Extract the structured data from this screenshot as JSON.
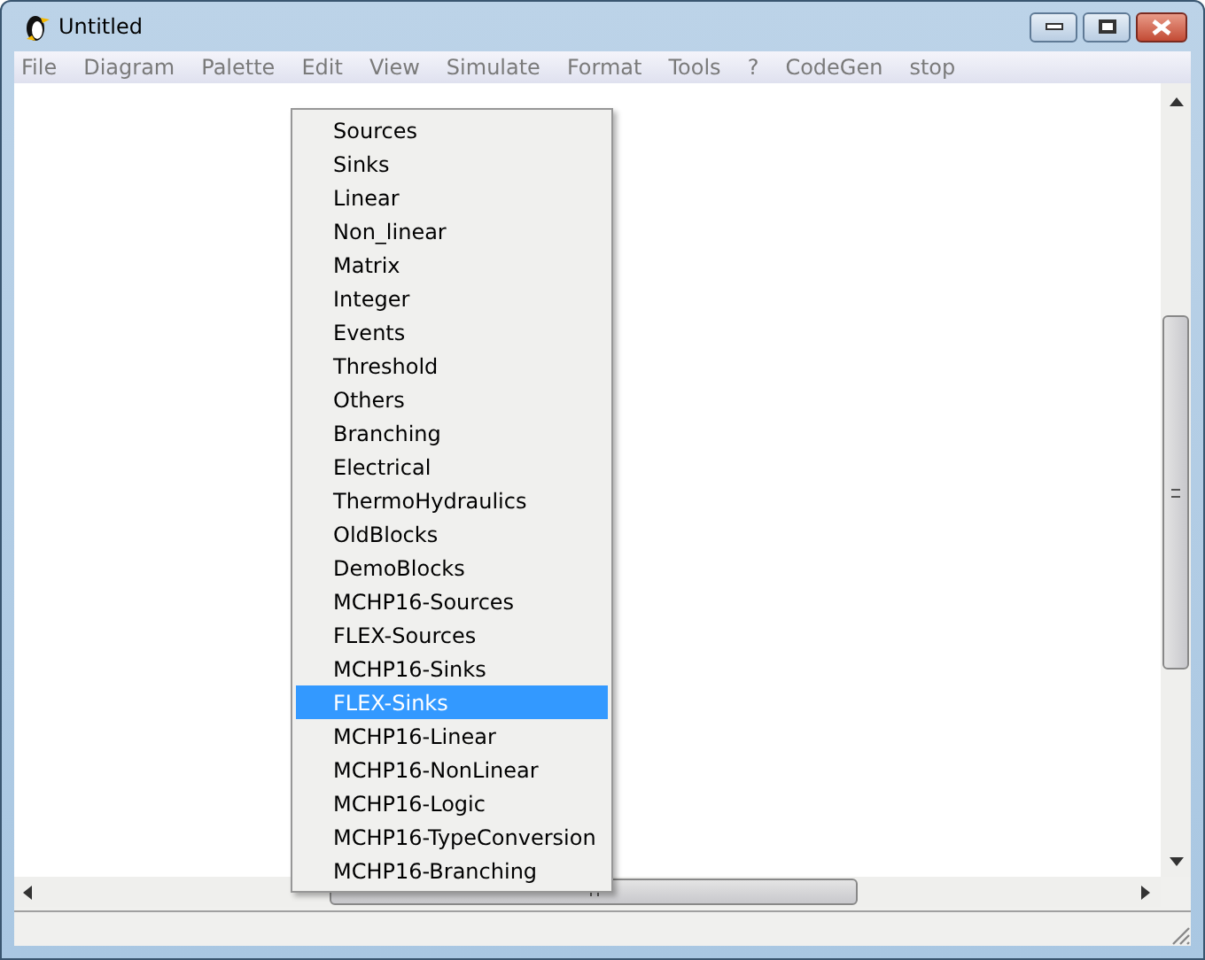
{
  "window": {
    "title": "Untitled"
  },
  "menu_bar": [
    "File",
    "Diagram",
    "Palette",
    "Edit",
    "View",
    "Simulate",
    "Format",
    "Tools",
    "?",
    "CodeGen",
    "stop"
  ],
  "palette_menu": [
    {
      "label": "Sources",
      "selected": false
    },
    {
      "label": "Sinks",
      "selected": false
    },
    {
      "label": "Linear",
      "selected": false
    },
    {
      "label": "Non_linear",
      "selected": false
    },
    {
      "label": "Matrix",
      "selected": false
    },
    {
      "label": "Integer",
      "selected": false
    },
    {
      "label": "Events",
      "selected": false
    },
    {
      "label": "Threshold",
      "selected": false
    },
    {
      "label": "Others",
      "selected": false
    },
    {
      "label": "Branching",
      "selected": false
    },
    {
      "label": "Electrical",
      "selected": false
    },
    {
      "label": "ThermoHydraulics",
      "selected": false
    },
    {
      "label": "OldBlocks",
      "selected": false
    },
    {
      "label": "DemoBlocks",
      "selected": false
    },
    {
      "label": "MCHP16-Sources",
      "selected": false
    },
    {
      "label": "FLEX-Sources",
      "selected": false
    },
    {
      "label": "MCHP16-Sinks",
      "selected": false
    },
    {
      "label": "FLEX-Sinks",
      "selected": true
    },
    {
      "label": "MCHP16-Linear",
      "selected": false
    },
    {
      "label": "MCHP16-NonLinear",
      "selected": false
    },
    {
      "label": "MCHP16-Logic",
      "selected": false
    },
    {
      "label": "MCHP16-TypeConversion",
      "selected": false
    },
    {
      "label": "MCHP16-Branching",
      "selected": false
    }
  ]
}
